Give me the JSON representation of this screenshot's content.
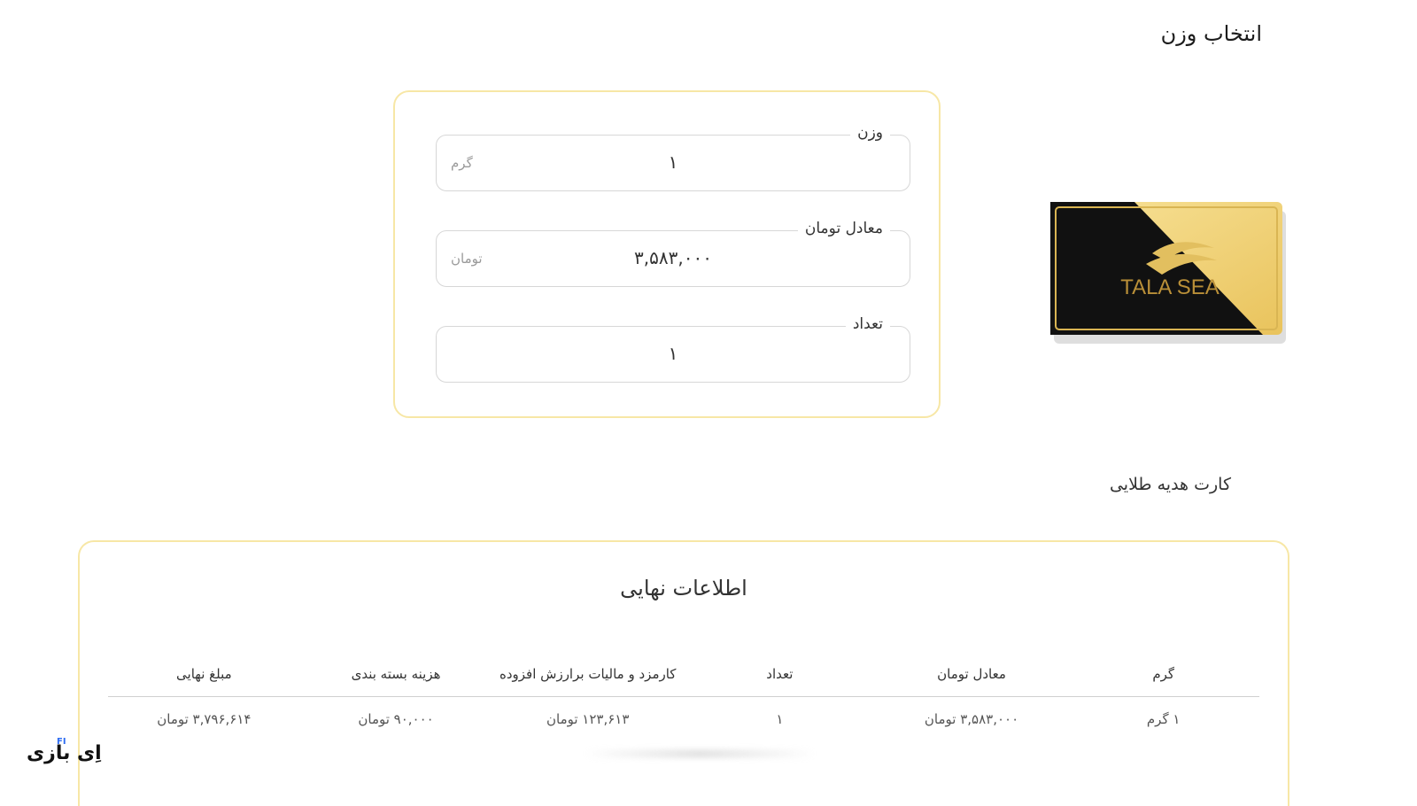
{
  "page": {
    "title": "انتخاب وزن"
  },
  "weight_form": {
    "weight": {
      "label": "وزن",
      "value": "۱",
      "unit": "گرم"
    },
    "toman": {
      "label": "معادل تومان",
      "value": "۳,۵۸۳,۰۰۰",
      "unit": "تومان"
    },
    "count": {
      "label": "تعداد",
      "value": "۱"
    }
  },
  "product": {
    "name": "کارت هدیه طلایی",
    "image_text": "TALA SEA",
    "colors": {
      "gold": "#f3d67a",
      "black": "#111111"
    }
  },
  "summary": {
    "title": "اطلاعات نهایی",
    "columns": [
      "گرم",
      "معادل تومان",
      "تعداد",
      "کارمزد و مالیات برارزش افزوده",
      "هزینه بسته بندی",
      "مبلغ نهایی"
    ],
    "rows": [
      [
        "۱ گرم",
        "۳,۵۸۳,۰۰۰ تومان",
        "۱",
        "۱۲۳,۶۱۳ تومان",
        "۹۰,۰۰۰ تومان",
        "۳,۷۹۶,۶۱۴ تومان"
      ]
    ]
  },
  "watermark": {
    "text": "اِی بازی",
    "badge": "FI"
  },
  "colors": {
    "accent_border": "#f7e7a6"
  }
}
